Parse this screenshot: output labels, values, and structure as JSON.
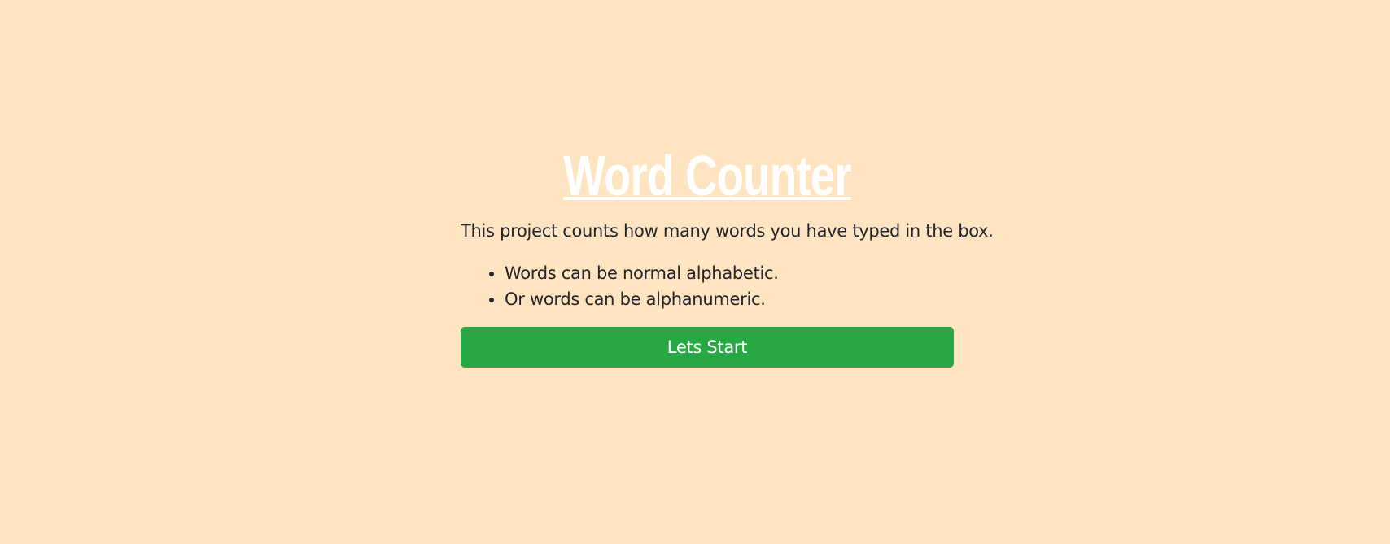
{
  "header": {
    "title": "Word Counter"
  },
  "main": {
    "description": "This project counts how many words you have typed in the box.",
    "rules": [
      "Words can be normal alphabetic.",
      "Or words can be alphanumeric."
    ],
    "start_button_label": "Lets Start"
  },
  "colors": {
    "background": "#ffe4c2",
    "title": "#ffffff",
    "button": "#28a745",
    "text": "#212529"
  }
}
